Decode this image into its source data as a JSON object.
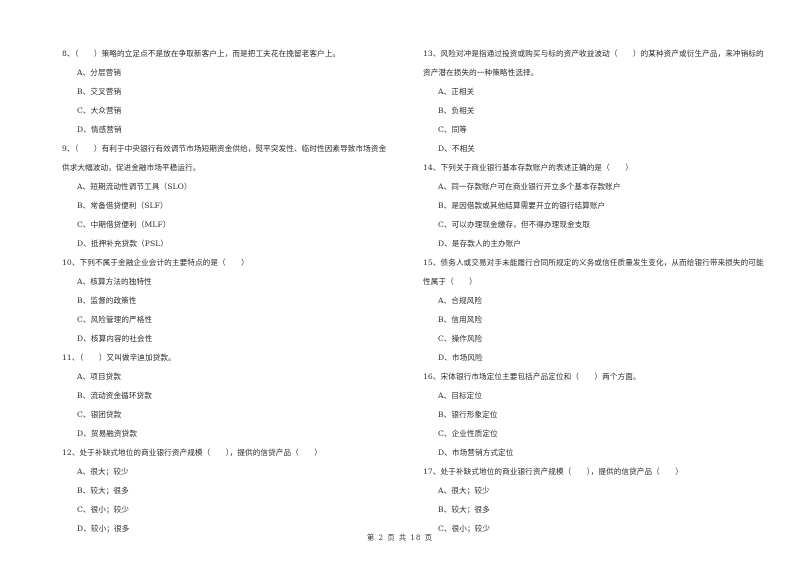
{
  "left_column": [
    {
      "stem": "8、（　　）策略的立足点不是放在争取新客户上，而是把工夫花在挽留老客户上。",
      "options": [
        "A、分层营销",
        "B、交叉营销",
        "C、大众营销",
        "D、情感营销"
      ]
    },
    {
      "stem": "9、（　　）有利于中央银行有效调节市场短期资金供给，熨平突发性、临时性因素导致市场资金供求大幅波动，促进金融市场平稳运行。",
      "options": [
        "A、短期流动性调节工具（SLO）",
        "B、常备借贷便利（SLF）",
        "C、中期借贷便利（MLF）",
        "D、抵押补充贷款（PSL）"
      ]
    },
    {
      "stem": "10、下列不属于金融企业会计的主要特点的是（　　）",
      "options": [
        "A、核算方法的独特性",
        "B、监督的政策性",
        "C、风险管理的严格性",
        "D、核算内容的社会性"
      ]
    },
    {
      "stem": "11、（　　）又叫做辛迪加贷款。",
      "options": [
        "A、项目贷款",
        "B、流动资金循环贷款",
        "C、银团贷款",
        "D、贸易融资贷款"
      ]
    },
    {
      "stem": "12、处于补缺式地位的商业银行资产规模（　　），提供的信贷产品（　　）",
      "options": [
        "A、很大；较少",
        "B、较大；很多",
        "C、很小；较少",
        "D、较小；很多"
      ]
    }
  ],
  "right_column": [
    {
      "stem": "13、风险对冲是指通过投资或购买与标的资产收益波动（　　）的某种资产或衍生产品，来冲销标的资产潜在损失的一种策略性选择。",
      "options": [
        "A、正相关",
        "B、负相关",
        "C、同等",
        "D、不相关"
      ]
    },
    {
      "stem": "14、下列关于商业银行基本存款账户的表述正确的是（　　）",
      "options": [
        "A、同一存款账户可在商业银行开立多个基本存款账户",
        "B、是因借款或其他结算需要开立的银行结算账户",
        "C、可以办理现金缴存，但不得办理现金支取",
        "D、是存款人的主办账户"
      ]
    },
    {
      "stem": "15、债务人或交易对手未能履行合同所规定的义务或信任质量发生变化，从而给银行带来损失的可能性属于（　　）",
      "options": [
        "A、合规风险",
        "B、信用风险",
        "C、操作风险",
        "D、市场风险"
      ]
    },
    {
      "stem": "16、宋体银行市场定位主要包括产品定位和（　　）两个方面。",
      "options": [
        "A、目标定位",
        "B、银行形象定位",
        "C、企业性质定位",
        "D、市场营销方式定位"
      ]
    },
    {
      "stem": "17、处于补缺式地位的商业银行资产规模（　　），提供的信贷产品（　　）",
      "options": [
        "A、很大；较少",
        "B、较大；很多",
        "C、很小；较少"
      ]
    }
  ],
  "footer": {
    "page_label": "第 2 页 共 18 页"
  }
}
